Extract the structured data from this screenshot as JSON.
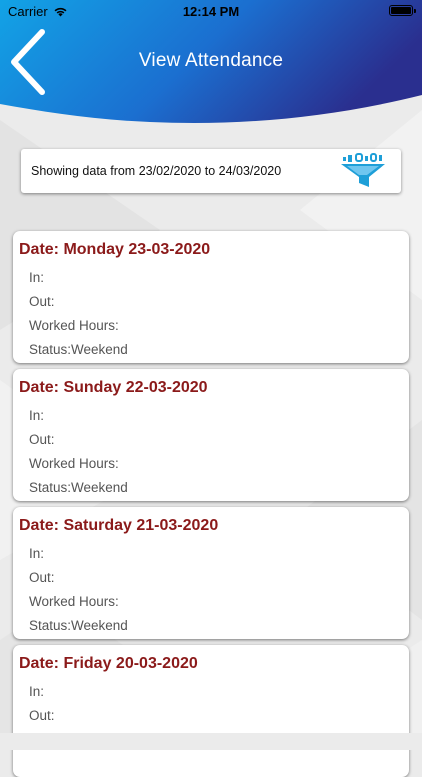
{
  "status_bar": {
    "carrier": "Carrier",
    "time": "12:14 PM"
  },
  "header": {
    "title": "View Attendance",
    "back_icon": "chevron-left-icon",
    "gradient_start": "#12a3e6",
    "gradient_end": "#2a2f8f"
  },
  "filter": {
    "text": "Showing data from 23/02/2020 to 24/03/2020",
    "icon": "filter-funnel-icon",
    "icon_color": "#1e9fd8"
  },
  "records": [
    {
      "date": "Date: Monday 23-03-2020",
      "in": "In:",
      "out": "Out:",
      "worked_hours": "Worked Hours:",
      "status": "Status:Weekend"
    },
    {
      "date": "Date: Sunday 22-03-2020",
      "in": "In:",
      "out": "Out:",
      "worked_hours": "Worked Hours:",
      "status": "Status:Weekend"
    },
    {
      "date": "Date: Saturday 21-03-2020",
      "in": "In:",
      "out": "Out:",
      "worked_hours": "Worked Hours:",
      "status": "Status:Weekend"
    },
    {
      "date": "Date: Friday 20-03-2020",
      "in": "In:",
      "out": "Out:"
    }
  ],
  "colors": {
    "date_text": "#8b1a1a",
    "detail_text": "#555555",
    "background": "#ebebeb"
  }
}
